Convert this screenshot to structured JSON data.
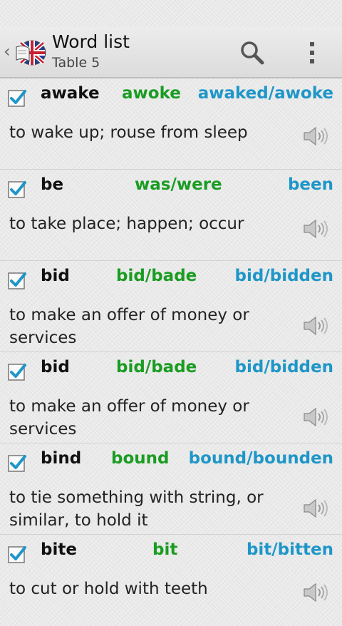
{
  "header": {
    "title": "Word list",
    "subtitle": "Table 5",
    "logo_icon": "union-jack-book-icon",
    "search_icon": "search-icon",
    "menu_icon": "overflow-menu-icon"
  },
  "entries": [
    {
      "base": "awake",
      "past": "awoke",
      "participle": "awaked/awoke",
      "definition": "to wake up; rouse from sleep",
      "checked": true
    },
    {
      "base": "be",
      "past": "was/were",
      "participle": "been",
      "definition": "to take place; happen; occur",
      "checked": true
    },
    {
      "base": "bid",
      "past": "bid/bade",
      "participle": "bid/bidden",
      "definition": "to make an offer of money or services",
      "checked": true
    },
    {
      "base": "bid",
      "past": "bid/bade",
      "participle": "bid/bidden",
      "definition": "to make an offer of money or services",
      "checked": true
    },
    {
      "base": "bind",
      "past": "bound",
      "participle": "bound/bounden",
      "definition": "to tie something with string, or similar, to hold it",
      "checked": true
    },
    {
      "base": "bite",
      "past": "bit",
      "participle": "bit/bitten",
      "definition": "to cut or hold with teeth",
      "checked": true
    }
  ],
  "colors": {
    "base": "#111111",
    "past": "#1a9c22",
    "participle": "#1e96c8",
    "checkbox": "#1e96c8"
  }
}
